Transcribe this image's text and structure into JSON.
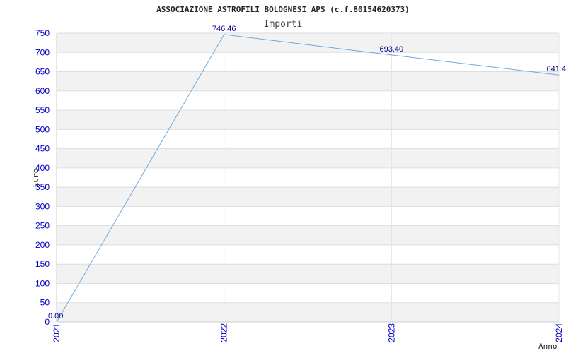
{
  "chart_data": {
    "type": "line",
    "title": "ASSOCIAZIONE ASTROFILI BOLOGNESI APS (c.f.80154620373)",
    "subtitle": "Importi",
    "xlabel": "Anno",
    "ylabel": "Euro",
    "categories": [
      "2021",
      "2022",
      "2023",
      "2024"
    ],
    "series": [
      {
        "values": [
          0.0,
          746.46,
          693.4,
          641.4
        ],
        "labels": [
          "0.00",
          "746.46",
          "693.40",
          "641.4"
        ],
        "color": "#6fa8dc"
      }
    ],
    "ylim": [
      0,
      750
    ],
    "yticks": [
      0,
      50,
      100,
      150,
      200,
      250,
      300,
      350,
      400,
      450,
      500,
      550,
      600,
      650,
      700,
      750
    ],
    "grid": true,
    "band_colors": [
      "#f2f2f2",
      "#ffffff"
    ],
    "tick_color": "#0000cc"
  }
}
